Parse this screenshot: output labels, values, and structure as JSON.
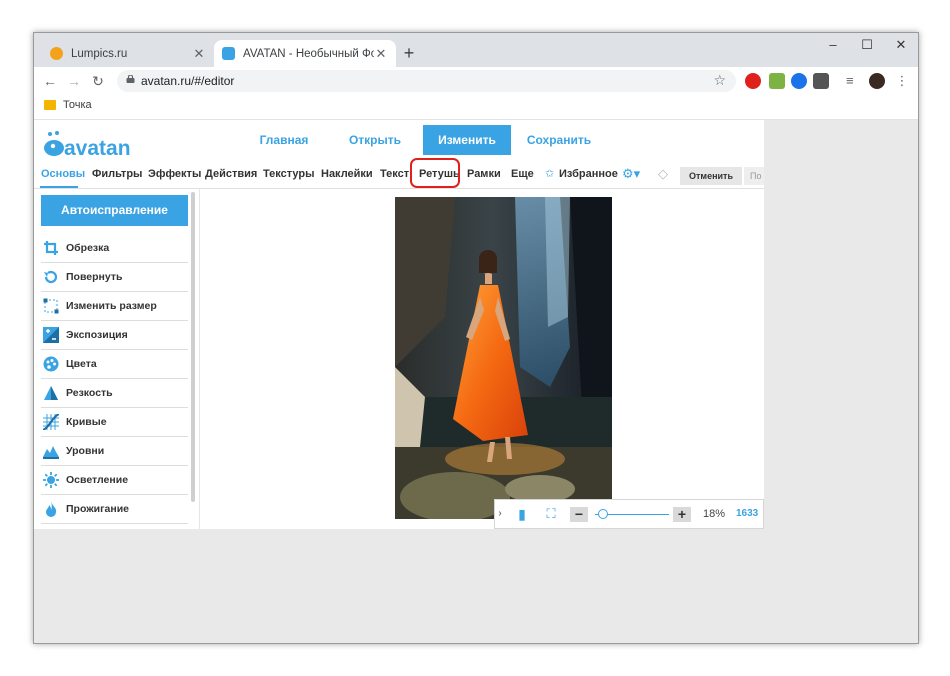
{
  "browser": {
    "tabs": [
      {
        "title": "Lumpics.ru",
        "color": "#f4a21c"
      },
      {
        "title": "AVATAN - Необычный Фоторед",
        "color": "#3aa3e3"
      }
    ],
    "url": "avatan.ru/#/editor",
    "bookmark": "Точка"
  },
  "app": {
    "brand": "avatan",
    "topnav": [
      "Главная",
      "Открыть",
      "Изменить",
      "Сохранить"
    ],
    "menu": [
      "Основы",
      "Фильтры",
      "Эффекты",
      "Действия",
      "Текстуры",
      "Наклейки",
      "Текст",
      "Ретушь",
      "Рамки",
      "Еще",
      "Избранное"
    ],
    "cancel": "Отменить",
    "next_partial": "По",
    "auto_fix": "Автоисправление",
    "tools": [
      "Обрезка",
      "Повернуть",
      "Изменить размер",
      "Экспозиция",
      "Цвета",
      "Резкость",
      "Кривые",
      "Уровни",
      "Осветление",
      "Прожигание"
    ],
    "zoom": {
      "percent": "18%",
      "size_partial": "1633",
      "level": 0.05
    },
    "accent": "#3aa3e3",
    "highlight": "#e0201b"
  }
}
